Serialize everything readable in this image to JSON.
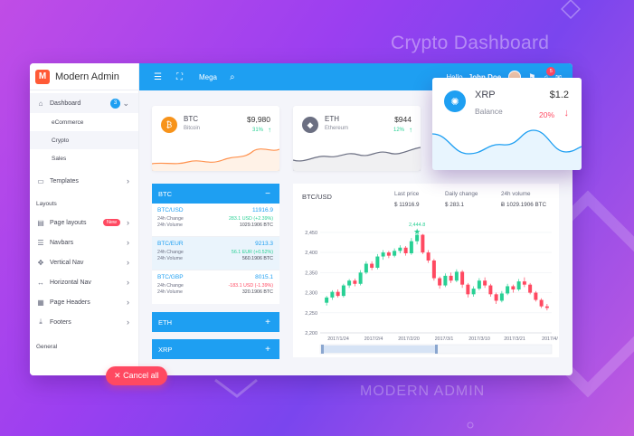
{
  "background": {
    "title": "Crypto Dashboard",
    "subtitle": "MODERN ADMIN"
  },
  "brand": {
    "name": "Modern Admin",
    "logo_letter": "M",
    "color": "#ff5a36"
  },
  "sidebar": {
    "dashboard": {
      "label": "Dashboard",
      "badge": "3"
    },
    "sub_items": [
      {
        "label": "eCommerce"
      },
      {
        "label": "Crypto"
      },
      {
        "label": "Sales"
      }
    ],
    "templates": {
      "label": "Templates"
    },
    "layouts_header": "Layouts",
    "page_layouts": {
      "label": "Page layouts",
      "badge": "New"
    },
    "navbars": {
      "label": "Navbars"
    },
    "vertical_nav": {
      "label": "Vertical Nav"
    },
    "horizontal_nav": {
      "label": "Horizontal Nav"
    },
    "page_headers": {
      "label": "Page Headers"
    },
    "footers": {
      "label": "Footers"
    },
    "general_header": "General"
  },
  "cancel_button": {
    "label": "Cancel all"
  },
  "topbar": {
    "mega_label": "Mega",
    "greeting": "Hello,",
    "user_name": "John Doe",
    "notif_count": "5",
    "color": "#1e9ff2"
  },
  "coins": {
    "btc": {
      "symbol": "BTC",
      "name": "Bitcoin",
      "price": "$9,980",
      "change": "31%",
      "color": "#f7931a"
    },
    "eth": {
      "symbol": "ETH",
      "name": "Ethereum",
      "price": "$944",
      "change": "12%",
      "color": "#6b6f82"
    },
    "xrp": {
      "symbol": "XRP",
      "name": "Balance",
      "price": "$1.2",
      "change": "20%",
      "color": "#1e9ff2"
    }
  },
  "btc_panel": {
    "header": "BTC",
    "labels": {
      "change": "24h Change",
      "volume": "24h Volume"
    },
    "pairs": [
      {
        "name": "BTC/USD",
        "price": "11916.9",
        "change": "283.1 USD (+2.39%)",
        "volume": "1029.1906 BTC",
        "dir": "pos"
      },
      {
        "name": "BTC/EUR",
        "price": "9213.3",
        "change": "56.1 EUR (+0.52%)",
        "volume": "560.1906 BTC",
        "dir": "pos"
      },
      {
        "name": "BTC/GBP",
        "price": "8015.1",
        "change": "-183.1 USD (-1.39%)",
        "volume": "320.1906 BTC",
        "dir": "neg"
      }
    ]
  },
  "eth_panel": {
    "header": "ETH"
  },
  "xrp_panel": {
    "header": "XRP"
  },
  "main_chart": {
    "title": "BTC/USD",
    "stats": [
      {
        "label": "Last price",
        "value": "$ 11916.9"
      },
      {
        "label": "Daily change",
        "value": "$ 283.1"
      },
      {
        "label": "24h volume",
        "value": "Ƀ 1029.1906 BTC"
      }
    ]
  },
  "chart_data": {
    "type": "candlestick",
    "title": "BTC/USD",
    "y_ticks": [
      2200,
      2250,
      2300,
      2350,
      2400,
      2450
    ],
    "x_ticks": [
      "2017/1/24",
      "2017/2/4",
      "2017/2/20",
      "2017/3/1",
      "2017/3/10",
      "2017/3/21",
      "2017/4/"
    ],
    "ylim": [
      2200,
      2470
    ],
    "annotation": {
      "label": "2,444.8",
      "value": 2444.8
    },
    "candles": [
      [
        2275,
        2288,
        2268,
        2292
      ],
      [
        2288,
        2302,
        2282,
        2306
      ],
      [
        2302,
        2292,
        2288,
        2308
      ],
      [
        2292,
        2318,
        2288,
        2322
      ],
      [
        2318,
        2330,
        2312,
        2334
      ],
      [
        2330,
        2322,
        2316,
        2335
      ],
      [
        2322,
        2350,
        2318,
        2356
      ],
      [
        2350,
        2372,
        2346,
        2378
      ],
      [
        2372,
        2362,
        2356,
        2378
      ],
      [
        2362,
        2390,
        2358,
        2396
      ],
      [
        2390,
        2400,
        2382,
        2406
      ],
      [
        2400,
        2392,
        2386,
        2404
      ],
      [
        2392,
        2404,
        2388,
        2410
      ],
      [
        2404,
        2412,
        2398,
        2418
      ],
      [
        2412,
        2398,
        2392,
        2416
      ],
      [
        2398,
        2428,
        2394,
        2436
      ],
      [
        2428,
        2444,
        2420,
        2447
      ],
      [
        2444,
        2400,
        2396,
        2446
      ],
      [
        2400,
        2380,
        2374,
        2406
      ],
      [
        2380,
        2336,
        2330,
        2384
      ],
      [
        2336,
        2318,
        2310,
        2340
      ],
      [
        2318,
        2342,
        2314,
        2348
      ],
      [
        2342,
        2330,
        2324,
        2350
      ],
      [
        2330,
        2352,
        2326,
        2358
      ],
      [
        2352,
        2320,
        2312,
        2356
      ],
      [
        2320,
        2296,
        2288,
        2324
      ],
      [
        2296,
        2310,
        2290,
        2316
      ],
      [
        2310,
        2330,
        2306,
        2336
      ],
      [
        2330,
        2318,
        2312,
        2338
      ],
      [
        2318,
        2296,
        2290,
        2322
      ],
      [
        2296,
        2280,
        2272,
        2300
      ],
      [
        2280,
        2298,
        2276,
        2304
      ],
      [
        2298,
        2316,
        2294,
        2322
      ],
      [
        2316,
        2308,
        2300,
        2320
      ],
      [
        2308,
        2328,
        2304,
        2334
      ],
      [
        2328,
        2320,
        2314,
        2338
      ],
      [
        2320,
        2300,
        2296,
        2324
      ],
      [
        2300,
        2282,
        2278,
        2304
      ],
      [
        2282,
        2266,
        2262,
        2286
      ],
      [
        2266,
        2262,
        2256,
        2272
      ]
    ]
  }
}
